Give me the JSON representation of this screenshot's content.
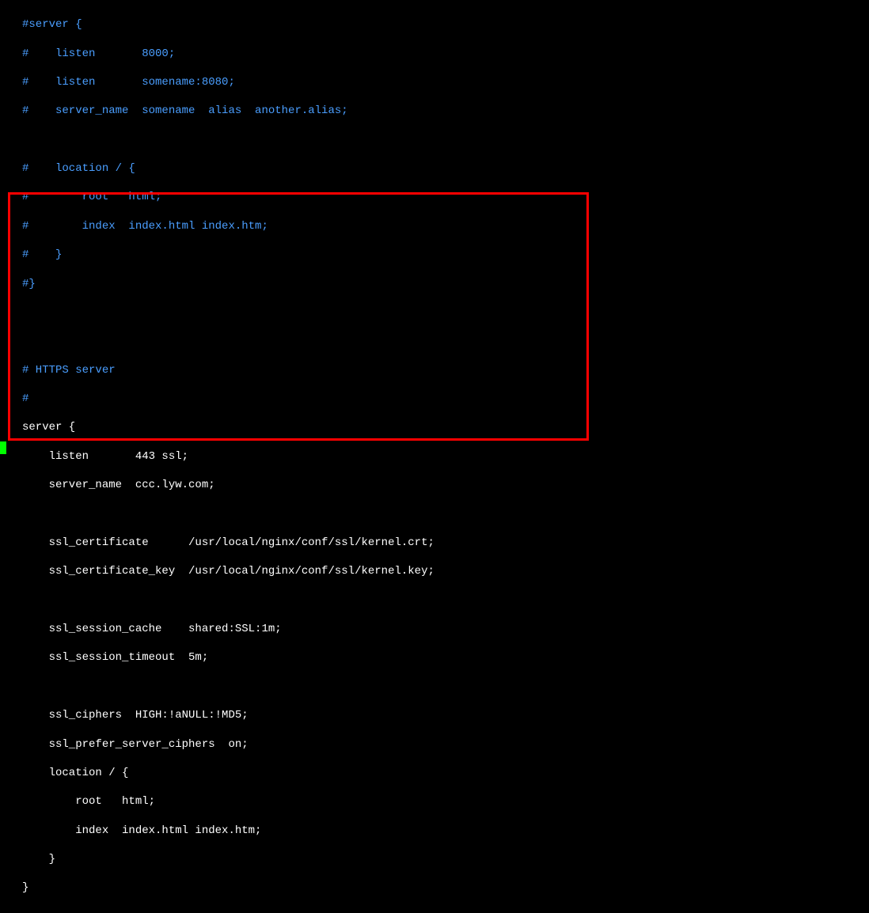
{
  "code": {
    "commented_block": [
      "#server {",
      "#    listen       8000;",
      "#    listen       somename:8080;",
      "#    server_name  somename  alias  another.alias;",
      "",
      "#    location / {",
      "#        root   html;",
      "#        index  index.html index.htm;",
      "#    }",
      "#}"
    ],
    "empty_lines_1": [
      "",
      ""
    ],
    "https_comment": [
      "# HTTPS server",
      "#"
    ],
    "server_block": [
      "server {",
      "    listen       443 ssl;",
      "    server_name  ccc.lyw.com;",
      "",
      "    ssl_certificate      /usr/local/nginx/conf/ssl/kernel.crt;",
      "    ssl_certificate_key  /usr/local/nginx/conf/ssl/kernel.key;",
      "",
      "    ssl_session_cache    shared:SSL:1m;",
      "    ssl_session_timeout  5m;",
      "",
      "    ssl_ciphers  HIGH:!aNULL:!MD5;",
      "    ssl_prefer_server_ciphers  on;",
      "    location / {",
      "        root   html;",
      "        index  index.html index.htm;",
      "    }",
      "}"
    ]
  },
  "cursor_char": "}"
}
